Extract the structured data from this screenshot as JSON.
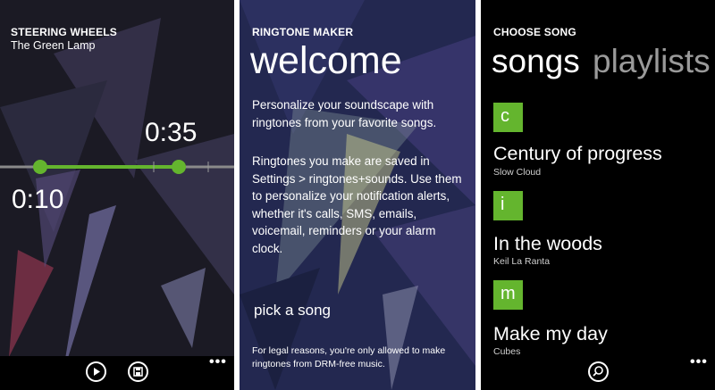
{
  "screen1": {
    "header": "STEERING WHEELS",
    "subtitle": "The Green Lamp",
    "end_time": "0:35",
    "start_time": "0:10",
    "accent": "#64b52e",
    "appbar": {
      "play_icon": "play-icon",
      "save_icon": "save-icon",
      "more": "•••"
    }
  },
  "screen2": {
    "header": "RINGTONE MAKER",
    "title": "welcome",
    "intro": "Personalize your soundscape with ringtones from your favorite songs.",
    "body": "Ringtones you make are saved in Settings > ringtones+sounds. Use them to personalize your notification alerts, whether it's calls, SMS, emails, voicemail, reminders or your alarm clock.",
    "pick_label": "pick a song",
    "legal": "For legal reasons, you're only allowed to make ringtones from DRM-free music."
  },
  "screen3": {
    "header": "CHOOSE SONG",
    "tabs": [
      {
        "label": "songs",
        "active": true
      },
      {
        "label": "playlists",
        "active": false
      }
    ],
    "groups": [
      {
        "letter": "c",
        "title": "Century of progress",
        "artist": "Slow Cloud"
      },
      {
        "letter": "i",
        "title": "In the woods",
        "artist": "Keil La Ranta"
      },
      {
        "letter": "m",
        "title": "Make my day",
        "artist": "Cubes"
      }
    ],
    "appbar": {
      "search_icon": "search-icon",
      "more": "•••"
    }
  }
}
